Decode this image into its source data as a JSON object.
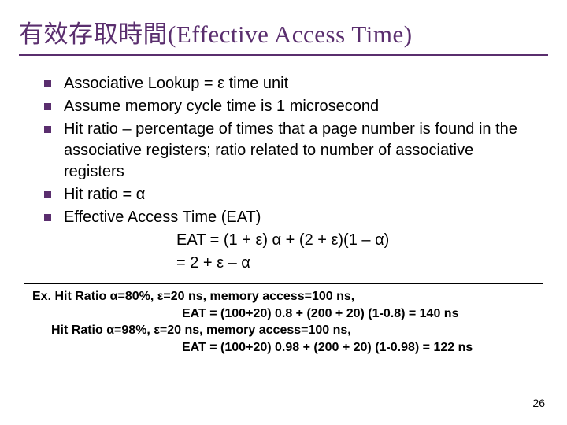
{
  "title": "有效存取時間(Effective Access Time)",
  "bullets": [
    "Associative Lookup = ε time unit",
    "Assume memory cycle time is 1 microsecond",
    "Hit ratio – percentage of times that a page number is found in the associative registers; ratio related to number of associative registers",
    "Hit ratio = α",
    "Effective Access Time (EAT)"
  ],
  "formulas": [
    "EAT = (1 + ε) α + (2 + ε)(1 – α)",
    "= 2 + ε – α"
  ],
  "example": {
    "line1": "Ex. Hit Ratio α=80%, ε=20 ns, memory access=100 ns,",
    "line2": "EAT = (100+20) 0.8 + (200 + 20) (1-0.8) = 140 ns",
    "line3": "Hit Ratio α=98%, ε=20 ns, memory access=100 ns,",
    "line4": "EAT = (100+20) 0.98 + (200 + 20) (1-0.98) = 122 ns"
  },
  "page_number": "26"
}
